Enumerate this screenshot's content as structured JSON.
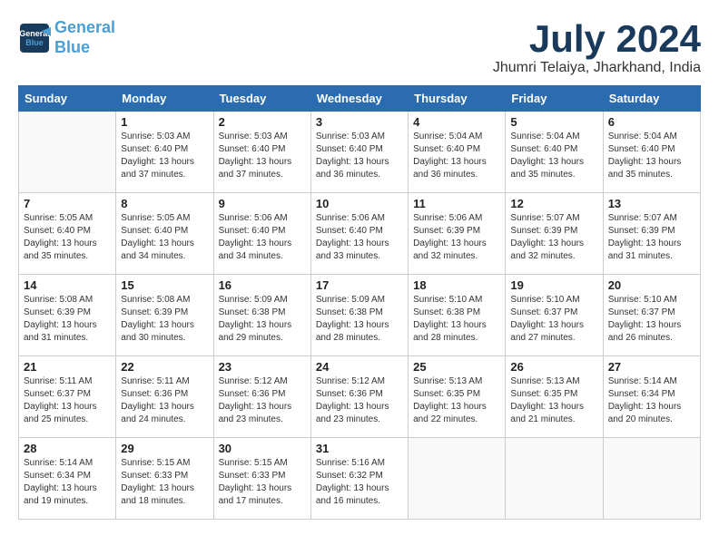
{
  "logo": {
    "line1": "General",
    "line2": "Blue"
  },
  "title": "July 2024",
  "location": "Jhumri Telaiya, Jharkhand, India",
  "headers": [
    "Sunday",
    "Monday",
    "Tuesday",
    "Wednesday",
    "Thursday",
    "Friday",
    "Saturday"
  ],
  "weeks": [
    [
      {
        "day": "",
        "info": ""
      },
      {
        "day": "1",
        "info": "Sunrise: 5:03 AM\nSunset: 6:40 PM\nDaylight: 13 hours\nand 37 minutes."
      },
      {
        "day": "2",
        "info": "Sunrise: 5:03 AM\nSunset: 6:40 PM\nDaylight: 13 hours\nand 37 minutes."
      },
      {
        "day": "3",
        "info": "Sunrise: 5:03 AM\nSunset: 6:40 PM\nDaylight: 13 hours\nand 36 minutes."
      },
      {
        "day": "4",
        "info": "Sunrise: 5:04 AM\nSunset: 6:40 PM\nDaylight: 13 hours\nand 36 minutes."
      },
      {
        "day": "5",
        "info": "Sunrise: 5:04 AM\nSunset: 6:40 PM\nDaylight: 13 hours\nand 35 minutes."
      },
      {
        "day": "6",
        "info": "Sunrise: 5:04 AM\nSunset: 6:40 PM\nDaylight: 13 hours\nand 35 minutes."
      }
    ],
    [
      {
        "day": "7",
        "info": "Sunrise: 5:05 AM\nSunset: 6:40 PM\nDaylight: 13 hours\nand 35 minutes."
      },
      {
        "day": "8",
        "info": "Sunrise: 5:05 AM\nSunset: 6:40 PM\nDaylight: 13 hours\nand 34 minutes."
      },
      {
        "day": "9",
        "info": "Sunrise: 5:06 AM\nSunset: 6:40 PM\nDaylight: 13 hours\nand 34 minutes."
      },
      {
        "day": "10",
        "info": "Sunrise: 5:06 AM\nSunset: 6:40 PM\nDaylight: 13 hours\nand 33 minutes."
      },
      {
        "day": "11",
        "info": "Sunrise: 5:06 AM\nSunset: 6:39 PM\nDaylight: 13 hours\nand 32 minutes."
      },
      {
        "day": "12",
        "info": "Sunrise: 5:07 AM\nSunset: 6:39 PM\nDaylight: 13 hours\nand 32 minutes."
      },
      {
        "day": "13",
        "info": "Sunrise: 5:07 AM\nSunset: 6:39 PM\nDaylight: 13 hours\nand 31 minutes."
      }
    ],
    [
      {
        "day": "14",
        "info": "Sunrise: 5:08 AM\nSunset: 6:39 PM\nDaylight: 13 hours\nand 31 minutes."
      },
      {
        "day": "15",
        "info": "Sunrise: 5:08 AM\nSunset: 6:39 PM\nDaylight: 13 hours\nand 30 minutes."
      },
      {
        "day": "16",
        "info": "Sunrise: 5:09 AM\nSunset: 6:38 PM\nDaylight: 13 hours\nand 29 minutes."
      },
      {
        "day": "17",
        "info": "Sunrise: 5:09 AM\nSunset: 6:38 PM\nDaylight: 13 hours\nand 28 minutes."
      },
      {
        "day": "18",
        "info": "Sunrise: 5:10 AM\nSunset: 6:38 PM\nDaylight: 13 hours\nand 28 minutes."
      },
      {
        "day": "19",
        "info": "Sunrise: 5:10 AM\nSunset: 6:37 PM\nDaylight: 13 hours\nand 27 minutes."
      },
      {
        "day": "20",
        "info": "Sunrise: 5:10 AM\nSunset: 6:37 PM\nDaylight: 13 hours\nand 26 minutes."
      }
    ],
    [
      {
        "day": "21",
        "info": "Sunrise: 5:11 AM\nSunset: 6:37 PM\nDaylight: 13 hours\nand 25 minutes."
      },
      {
        "day": "22",
        "info": "Sunrise: 5:11 AM\nSunset: 6:36 PM\nDaylight: 13 hours\nand 24 minutes."
      },
      {
        "day": "23",
        "info": "Sunrise: 5:12 AM\nSunset: 6:36 PM\nDaylight: 13 hours\nand 23 minutes."
      },
      {
        "day": "24",
        "info": "Sunrise: 5:12 AM\nSunset: 6:36 PM\nDaylight: 13 hours\nand 23 minutes."
      },
      {
        "day": "25",
        "info": "Sunrise: 5:13 AM\nSunset: 6:35 PM\nDaylight: 13 hours\nand 22 minutes."
      },
      {
        "day": "26",
        "info": "Sunrise: 5:13 AM\nSunset: 6:35 PM\nDaylight: 13 hours\nand 21 minutes."
      },
      {
        "day": "27",
        "info": "Sunrise: 5:14 AM\nSunset: 6:34 PM\nDaylight: 13 hours\nand 20 minutes."
      }
    ],
    [
      {
        "day": "28",
        "info": "Sunrise: 5:14 AM\nSunset: 6:34 PM\nDaylight: 13 hours\nand 19 minutes."
      },
      {
        "day": "29",
        "info": "Sunrise: 5:15 AM\nSunset: 6:33 PM\nDaylight: 13 hours\nand 18 minutes."
      },
      {
        "day": "30",
        "info": "Sunrise: 5:15 AM\nSunset: 6:33 PM\nDaylight: 13 hours\nand 17 minutes."
      },
      {
        "day": "31",
        "info": "Sunrise: 5:16 AM\nSunset: 6:32 PM\nDaylight: 13 hours\nand 16 minutes."
      },
      {
        "day": "",
        "info": ""
      },
      {
        "day": "",
        "info": ""
      },
      {
        "day": "",
        "info": ""
      }
    ]
  ]
}
